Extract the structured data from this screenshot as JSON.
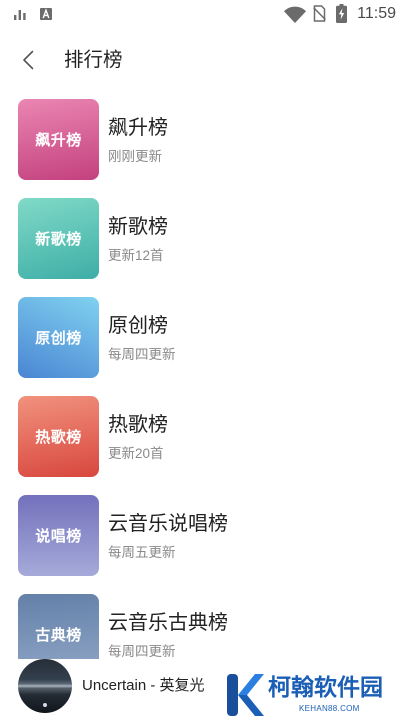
{
  "status_bar": {
    "time": "11:59",
    "icons_left": [
      "signal-bars-icon",
      "font-a-icon"
    ],
    "icons_right": [
      "wifi-icon",
      "no-sim-icon",
      "battery-charging-icon"
    ]
  },
  "header": {
    "title": "排行榜",
    "back_icon": "chevron-left-icon"
  },
  "charts": [
    {
      "cover_label": "飙升榜",
      "title": "飙升榜",
      "subtitle": "刚刚更新",
      "colors": {
        "top": "#ea86b2",
        "bottom": "#c3417e"
      }
    },
    {
      "cover_label": "新歌榜",
      "title": "新歌榜",
      "subtitle": "更新12首",
      "colors": {
        "top": "#80dac7",
        "bottom": "#3eaea7"
      }
    },
    {
      "cover_label": "原创榜",
      "title": "原创榜",
      "subtitle": "每周四更新",
      "colors": {
        "top": "#80d2f0",
        "bottom": "#4a85d3"
      }
    },
    {
      "cover_label": "热歌榜",
      "title": "热歌榜",
      "subtitle": "更新20首",
      "colors": {
        "top": "#f1927e",
        "bottom": "#d8473e"
      }
    },
    {
      "cover_label": "说唱榜",
      "title": "云音乐说唱榜",
      "subtitle": "每周五更新",
      "colors": {
        "top": "#7371bc",
        "bottom": "#a5aad9"
      }
    },
    {
      "cover_label": "古典榜",
      "title": "云音乐古典榜",
      "subtitle": "每周四更新",
      "colors": {
        "top": "#6380a8",
        "bottom": "#8fa6c6"
      }
    }
  ],
  "player": {
    "now_playing": "Uncertain - 英复光"
  },
  "watermark": {
    "brand": "柯翰软件园",
    "domain": "KEHAN88.COM",
    "color": "#1b5eb6",
    "logo_icon": "kehan-k-logo-icon"
  }
}
